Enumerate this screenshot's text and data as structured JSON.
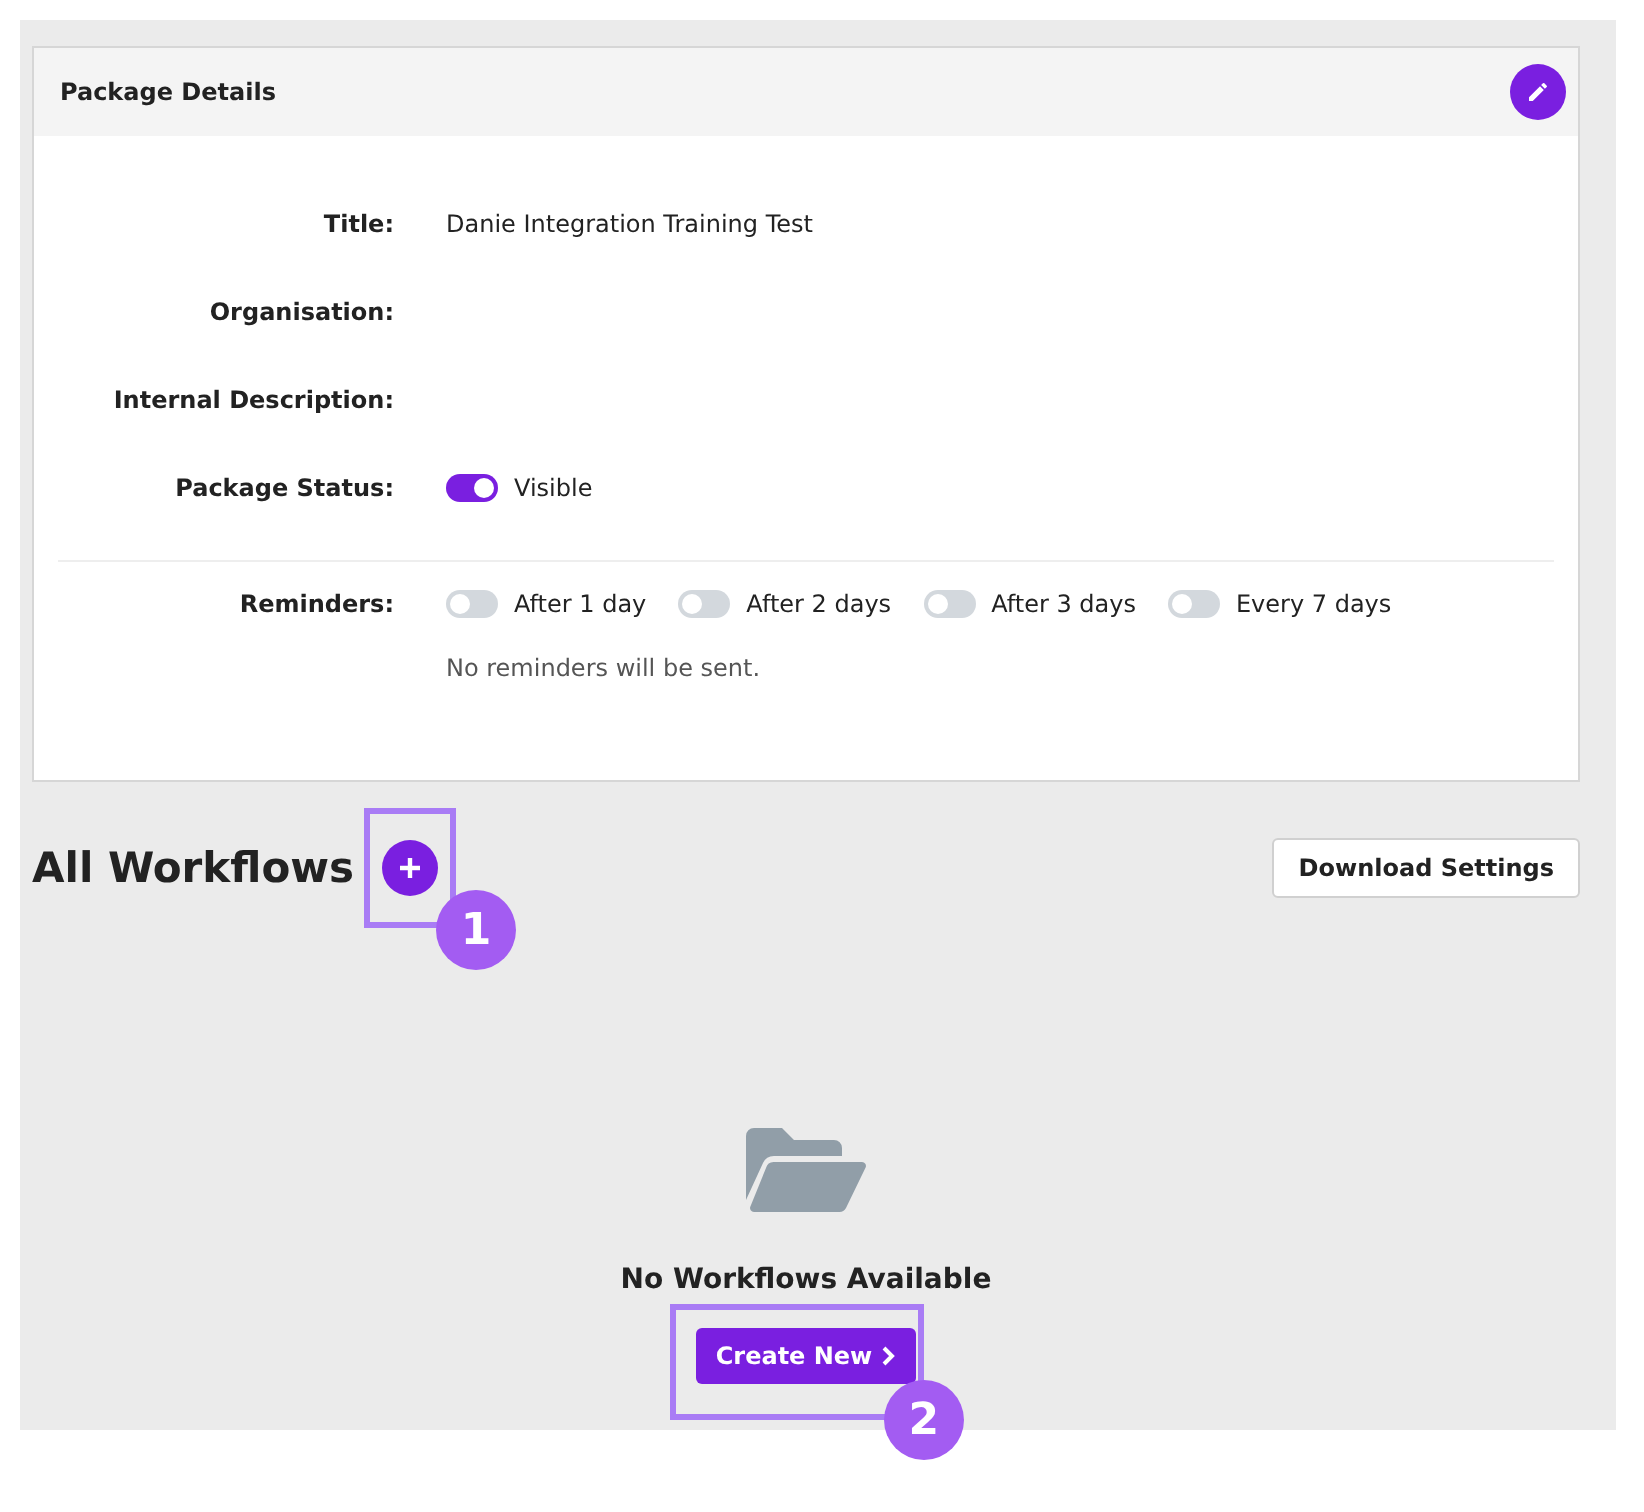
{
  "card": {
    "title": "Package Details",
    "fields": [
      {
        "label": "Title:",
        "value": "Danie Integration Training Test"
      },
      {
        "label": "Organisation:"
      },
      {
        "label": "Internal Description:"
      }
    ],
    "status": {
      "label": "Package Status:",
      "on": true,
      "text": "Visible"
    },
    "reminders": {
      "label": "Reminders:",
      "options": [
        {
          "text": "After 1 day",
          "on": false
        },
        {
          "text": "After 2 days",
          "on": false
        },
        {
          "text": "After 3 days",
          "on": false
        },
        {
          "text": "Every 7 days",
          "on": false
        }
      ],
      "note": "No reminders will be sent."
    }
  },
  "workflows": {
    "title": "All Workflows",
    "download_button": "Download Settings",
    "empty_text": "No Workflows Available",
    "create_button": "Create New"
  },
  "annotations": [
    "1",
    "2"
  ]
}
